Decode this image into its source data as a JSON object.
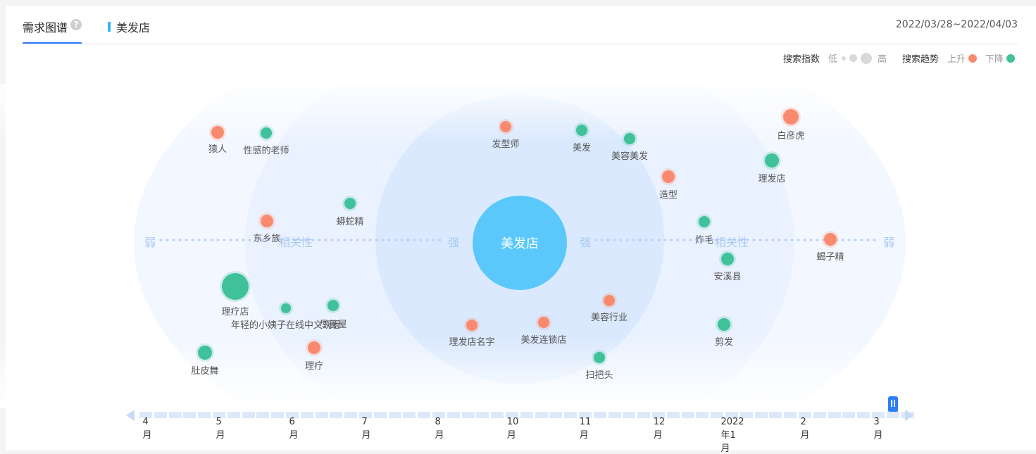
{
  "tabs": {
    "main": "需求图谱",
    "keyword": "美发店"
  },
  "date_range": "2022/03/28~2022/04/03",
  "legend": {
    "index_label": "搜索指数",
    "low": "低",
    "high": "高",
    "trend_label": "搜索趋势",
    "up": "上升",
    "down": "下降",
    "up_color": "#f98a6f",
    "down_color": "#3fc19a"
  },
  "center": {
    "label": "美发店",
    "color": "#5ac8fa"
  },
  "axis": {
    "relevance": "相关性",
    "strong": "强",
    "weak": "弱"
  },
  "nodes": [
    {
      "label": "猿人",
      "trend": "up"
    },
    {
      "label": "性感的老师",
      "trend": "down"
    },
    {
      "label": "发型师",
      "trend": "up"
    },
    {
      "label": "美发",
      "trend": "down"
    },
    {
      "label": "美容美发",
      "trend": "down"
    },
    {
      "label": "白彦虎",
      "trend": "up"
    },
    {
      "label": "理发店",
      "trend": "down"
    },
    {
      "label": "造型",
      "trend": "up"
    },
    {
      "label": "蟒蛇精",
      "trend": "down"
    },
    {
      "label": "东乡族",
      "trend": "up"
    },
    {
      "label": "炸毛",
      "trend": "down"
    },
    {
      "label": "蝎子精",
      "trend": "up"
    },
    {
      "label": "安溪县",
      "trend": "down"
    },
    {
      "label": "理疗店",
      "trend": "down"
    },
    {
      "label": "年轻的小姨子在线中文观看",
      "trend": "down"
    },
    {
      "label": "尽善屋",
      "trend": "down"
    },
    {
      "label": "美容行业",
      "trend": "up"
    },
    {
      "label": "理发店名字",
      "trend": "up"
    },
    {
      "label": "美发连锁店",
      "trend": "up"
    },
    {
      "label": "剪发",
      "trend": "down"
    },
    {
      "label": "肚皮舞",
      "trend": "down"
    },
    {
      "label": "理疗",
      "trend": "up"
    },
    {
      "label": "扫把头",
      "trend": "down"
    }
  ],
  "timeline": {
    "months": [
      "4月",
      "5月",
      "6月",
      "7月",
      "8月",
      "10月",
      "11月",
      "12月",
      "2022年1月",
      "2月",
      "3月"
    ]
  }
}
